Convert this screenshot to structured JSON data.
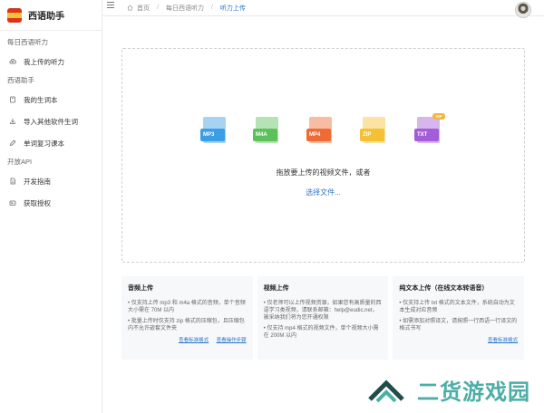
{
  "brand": {
    "name": "西语助手",
    "caret": "⌄"
  },
  "sidebar": {
    "sections": [
      {
        "title": "每日西语听力",
        "items": [
          "我上传的听力"
        ]
      },
      {
        "title": "西语助手",
        "items": [
          "我的生词本",
          "导入其他软件生词",
          "单词复习课本"
        ]
      },
      {
        "title": "开放API",
        "items": [
          "开发指南",
          "获取授权"
        ]
      }
    ]
  },
  "breadcrumb": {
    "home": "首页",
    "parent": "每日西语听力",
    "current": "听力上传",
    "sep": "/"
  },
  "upload": {
    "file_types": [
      {
        "label": "MP3",
        "color": "#3b9de5"
      },
      {
        "label": "M4A",
        "color": "#5cc15b"
      },
      {
        "label": "MP4",
        "color": "#ef6b33"
      },
      {
        "label": "ZIP",
        "color": "#f4c133"
      },
      {
        "label": "TXT",
        "color": "#a45dd8"
      }
    ],
    "vip_badge": "VIP",
    "drop_text": "拖放要上传的视频文件，或者",
    "select_link": "选择文件..."
  },
  "cards": [
    {
      "title": "音频上传",
      "lines": [
        "• 仅支持上传 mp3 和 m4a 格式的音频，单个音频大小需在 70M 以内",
        "• 批量上传时仅支持 zip 格式的压缩包，且压缩包内不允许嵌套文件夹"
      ],
      "links": [
        "查看标准格式",
        "查看操作步骤"
      ]
    },
    {
      "title": "视频上传",
      "lines": [
        "• 仅老师可以上传视频资源，如果您有高质量的西语学习类视频，请联系邮箱：help@eudic.net，被采纳我们将为您开通权限",
        "• 仅支持 mp4 格式的视频文件，单个视频大小需在 200M 以内"
      ],
      "links": []
    },
    {
      "title": "纯文本上传（在线文本转语音）",
      "lines": [
        "• 仅支持上传 txt 格式的文本文件，系统自动为文本生成对应音频",
        "• 如需添加对照译文，请按照一行西语一行译文的格式书写"
      ],
      "links": [
        "查看标准格式"
      ]
    }
  ],
  "watermark": {
    "text": "二货游戏园"
  }
}
